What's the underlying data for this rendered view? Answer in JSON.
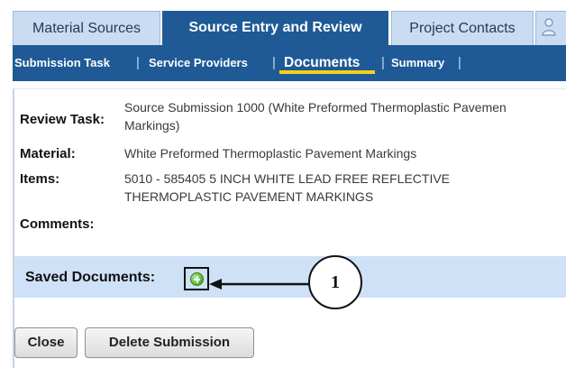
{
  "tabs": {
    "items": [
      {
        "label": "Material Sources"
      },
      {
        "label": "Source Entry and Review"
      },
      {
        "label": "Project Contacts"
      }
    ],
    "user_icon": "user-icon"
  },
  "subnav": {
    "items": [
      {
        "label": "Submission Task"
      },
      {
        "label": "Service Providers"
      },
      {
        "label": "Documents"
      },
      {
        "label": "Summary"
      }
    ],
    "separator": "|",
    "active_underline_color": "#f4d218"
  },
  "details": {
    "review_task_label": "Review Task:",
    "review_task_line1": "Source Submission 1000 (White Preformed Thermoplastic Pavemen",
    "review_task_line2": "Markings)",
    "material_label": "Material:",
    "material_value": "White Preformed Thermoplastic Pavement Markings",
    "items_label": "Items:",
    "items_line1": "5010 - 585405 5 INCH WHITE LEAD FREE REFLECTIVE",
    "items_line2": "THERMOPLASTIC PAVEMENT MARKINGS",
    "comments_label": "Comments:"
  },
  "saved_documents": {
    "label": "Saved Documents:",
    "add_icon": "add-icon"
  },
  "buttons": {
    "close_label": "Close",
    "delete_label": "Delete Submission"
  },
  "callout": {
    "number": "1"
  },
  "colors": {
    "tab_active": "#1f5a96",
    "tab_inactive": "#c9dcf2",
    "saved_bar": "#cfe1f7",
    "add_icon_green": "#55b92d"
  }
}
